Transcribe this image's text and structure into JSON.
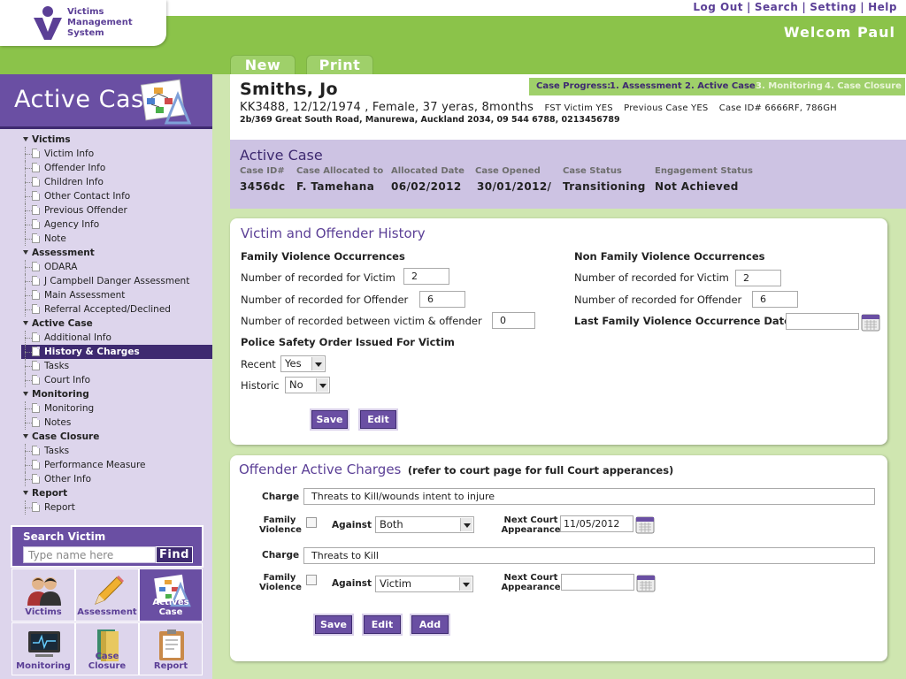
{
  "app": {
    "name_lines": [
      "Victims",
      "Management",
      "System"
    ]
  },
  "top_links": [
    "Log Out",
    "Search",
    "Setting",
    "Help"
  ],
  "welcome": "Welcom Paul",
  "tabs": [
    "New",
    "Print"
  ],
  "sidebar": {
    "title": "Active Case",
    "tree": [
      {
        "group": "Victims",
        "items": [
          "Victim Info",
          "Offender Info",
          "Children Info",
          "Other Contact Info",
          "Previous Offender",
          "Agency Info",
          "Note"
        ]
      },
      {
        "group": "Assessment",
        "items": [
          "ODARA",
          "J Campbell Danger Assessment",
          "Main Assessment",
          "Referral Accepted/Declined"
        ]
      },
      {
        "group": "Active Case",
        "items": [
          "Additional Info",
          "History & Charges",
          "Tasks",
          "Court Info"
        ]
      },
      {
        "group": "Monitoring",
        "items": [
          "Monitoring",
          "Notes"
        ]
      },
      {
        "group": "Case Closure",
        "items": [
          "Tasks",
          "Performance Measure",
          "Other Info"
        ]
      },
      {
        "group": "Report",
        "items": [
          "Report"
        ]
      }
    ],
    "active_item": "History & Charges",
    "search": {
      "label": "Search Victim",
      "placeholder": "Type name here",
      "button": "Find"
    },
    "tiles": [
      {
        "label": "Victims",
        "icon": "people-icon"
      },
      {
        "label": "Assessment",
        "icon": "pencil-icon"
      },
      {
        "label": "Actives Case",
        "icon": "flowchart-icon",
        "selected": true
      },
      {
        "label": "Monitoring",
        "icon": "monitor-icon"
      },
      {
        "label": "Case Closure",
        "icon": "folder-icon"
      },
      {
        "label": "Report",
        "icon": "clipboard-icon"
      }
    ]
  },
  "patient": {
    "name": "Smiths, Jo",
    "details": "KK3488, 12/12/1974 , Female, 37 yeras, 8months",
    "fst_victim": "FST Victim YES",
    "previous_case": "Previous Case YES",
    "case_ids": "Case ID# 6666RF, 786GH",
    "address": "2b/369 Great South Road, Manurewa, Auckland 2034, 09 544 6788, 0213456789"
  },
  "case_progress": {
    "label": "Case Progress:",
    "steps": [
      "1. Assessment",
      "2. Active Case",
      "3. Monitoring",
      "4. Case Closure"
    ],
    "done": 2
  },
  "active_case": {
    "title": "Active Case",
    "fields": [
      {
        "label": "Case ID#",
        "value": "3456dc"
      },
      {
        "label": "Case Allocated to",
        "value": "F. Tamehana"
      },
      {
        "label": "Allocated Date",
        "value": "06/02/2012"
      },
      {
        "label": "Case Opened",
        "value": "30/01/2012/"
      },
      {
        "label": "Case Status",
        "value": "Transitioning"
      },
      {
        "label": "Engagement Status",
        "value": "Not Achieved"
      }
    ]
  },
  "history": {
    "title": "Victim and Offender History",
    "family": {
      "heading": "Family Violence Occurrences",
      "victim_label": "Number of recorded for Victim",
      "victim_value": "2",
      "offender_label": "Number of recorded for Offender",
      "offender_value": "6",
      "between_label": "Number of recorded between victim & offender",
      "between_value": "0"
    },
    "police": {
      "heading": "Police Safety Order Issued For Victim",
      "recent_label": "Recent",
      "recent_value": "Yes",
      "historic_label": "Historic",
      "historic_value": "No"
    },
    "nonfamily": {
      "heading": "Non Family Violence Occurrences",
      "victim_label": "Number of recorded for Victim",
      "victim_value": "2",
      "offender_label": "Number of recorded for Offender",
      "offender_value": "6",
      "last_date_label": "Last Family Violence Occurrence Date",
      "last_date_value": ""
    },
    "buttons": [
      "Save",
      "Edit"
    ]
  },
  "charges": {
    "title": "Offender Active Charges",
    "note": "(refer to court page for full Court apperances)",
    "charge_label": "Charge",
    "family_violence_label": [
      "Family",
      "Violence"
    ],
    "against_label": "Against",
    "next_court_label": [
      "Next Court",
      "Appearance"
    ],
    "rows": [
      {
        "charge": "Threats to Kill/wounds intent to injure",
        "against": "Both",
        "next_court": "11/05/2012"
      },
      {
        "charge": "Threats to Kill",
        "against": "Victim",
        "next_court": ""
      }
    ],
    "buttons": [
      "Save",
      "Edit",
      "Add"
    ]
  }
}
